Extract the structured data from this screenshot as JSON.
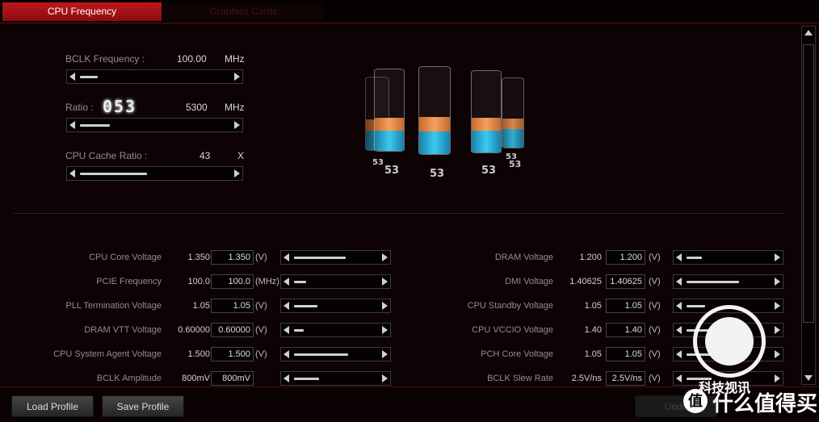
{
  "tabs": [
    {
      "label": "CPU Frequency",
      "active": true
    },
    {
      "label": "Graphics Cards",
      "active": false
    }
  ],
  "top": {
    "bclk": {
      "label": "BCLK Frequency :",
      "value": "100.00",
      "unit": "MHz",
      "level": 0.12
    },
    "ratio": {
      "label": "Ratio :",
      "digits": "053",
      "value": "5300",
      "unit": "MHz",
      "level": 0.2
    },
    "cache": {
      "label": "CPU Cache Ratio :",
      "value": "43",
      "unit": "X",
      "level": 0.45
    }
  },
  "cores": [
    "53",
    "53",
    "53",
    "53",
    "53",
    "53"
  ],
  "left_rows": [
    {
      "label": "CPU Core Voltage",
      "value": "1.350",
      "input": "1.350",
      "unit": "(V)",
      "level": 0.62
    },
    {
      "label": "PCIE Frequency",
      "value": "100.0",
      "input": "100.0",
      "unit": "(MHz)",
      "level": 0.15
    },
    {
      "label": "PLL Termination Voltage",
      "value": "1.05",
      "input": "1.05",
      "unit": "(V)",
      "level": 0.28
    },
    {
      "label": "DRAM VTT Voltage",
      "value": "0.60000",
      "input": "0.60000",
      "unit": "(V)",
      "level": 0.12
    },
    {
      "label": "CPU System Agent Voltage",
      "value": "1.500",
      "input": "1.500",
      "unit": "(V)",
      "level": 0.65
    },
    {
      "label": "BCLK Amplitude",
      "value": "800mV",
      "input": "800mV",
      "unit": "",
      "level": 0.3
    }
  ],
  "right_rows": [
    {
      "label": "DRAM Voltage",
      "value": "1.200",
      "input": "1.200",
      "unit": "(V)",
      "level": 0.18
    },
    {
      "label": "DMI Voltage",
      "value": "1.40625",
      "input": "1.40625",
      "unit": "(V)",
      "level": 0.63
    },
    {
      "label": "CPU Standby Voltage",
      "value": "1.05",
      "input": "1.05",
      "unit": "(V)",
      "level": 0.22
    },
    {
      "label": "CPU VCCIO Voltage",
      "value": "1.40",
      "input": "1.40",
      "unit": "(V)",
      "level": 0.3
    },
    {
      "label": "PCH Core Voltage",
      "value": "1.05",
      "input": "1.05",
      "unit": "(V)",
      "level": 0.3
    },
    {
      "label": "BCLK Slew Rate",
      "value": "2.5V/ns",
      "input": "2.5V/ns",
      "unit": "(V)",
      "level": 0.3
    }
  ],
  "footer": {
    "load": "Load Profile",
    "save": "Save Profile",
    "undo": "Undo"
  },
  "watermark": {
    "line1": "科技视讯",
    "line2": "什么值得买",
    "badge": "值"
  },
  "colors": {
    "accent": "#c0161c",
    "background": "#0d0304",
    "orange": "#f5a060",
    "blue": "#3ccaf0"
  }
}
